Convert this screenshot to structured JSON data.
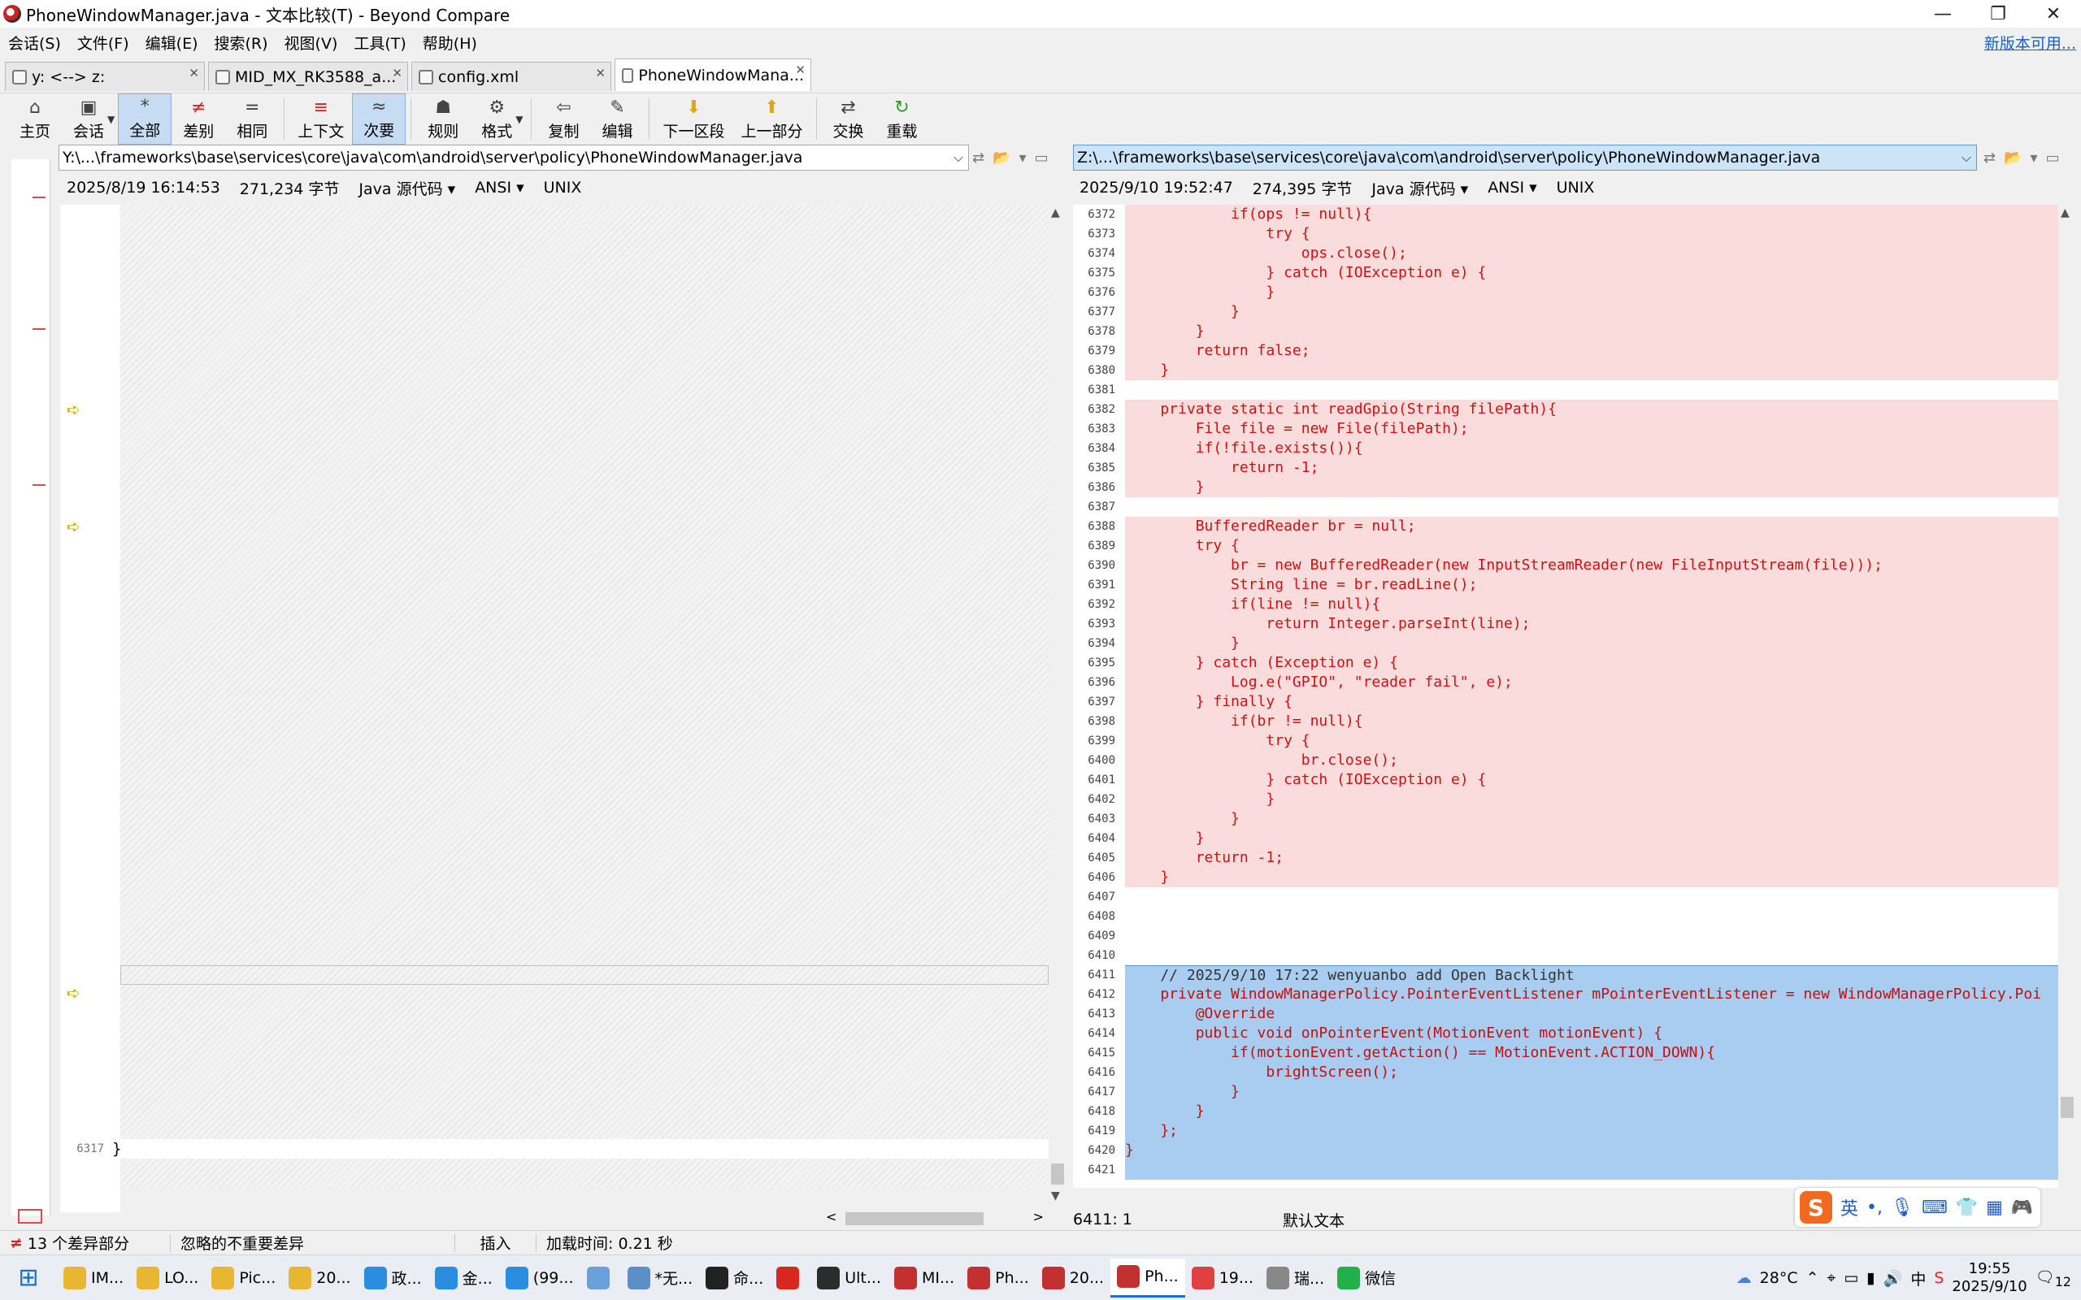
{
  "window": {
    "title": "PhoneWindowManager.java - 文本比较(T) - Beyond Compare",
    "controls": [
      "—",
      "❐",
      "✕"
    ]
  },
  "menu": {
    "items": [
      "会话(S)",
      "文件(F)",
      "编辑(E)",
      "搜索(R)",
      "视图(V)",
      "工具(T)",
      "帮助(H)"
    ],
    "update_link": "新版本可用..."
  },
  "tabs": [
    {
      "label": "y: <--> z:",
      "active": false
    },
    {
      "label": "MID_MX_RK3588_a...",
      "active": false
    },
    {
      "label": "config.xml",
      "active": false
    },
    {
      "label": "PhoneWindowMana...",
      "active": true
    }
  ],
  "toolbar": {
    "home": "主页",
    "session": "会话",
    "all": "全部",
    "diffs": "差别",
    "same": "相同",
    "context": "上下文",
    "minor": "次要",
    "rules": "规则",
    "format": "格式",
    "copy": "复制",
    "edit": "编辑",
    "next_section": "下一区段",
    "prev_section": "上一部分",
    "swap": "交换",
    "reload": "重载"
  },
  "left": {
    "path": "Y:\\...\\frameworks\\base\\services\\core\\java\\com\\android\\server\\policy\\PhoneWindowManager.java",
    "date": "2025/8/19 16:14:53",
    "size": "271,234 字节",
    "format": "Java 源代码",
    "encoding": "ANSI",
    "line_ending": "UNIX",
    "last_line_no": "6317",
    "last_line_text": "}"
  },
  "right": {
    "path": "Z:\\...\\frameworks\\base\\services\\core\\java\\com\\android\\server\\policy\\PhoneWindowManager.java",
    "date": "2025/9/10 19:52:47",
    "size": "274,395 字节",
    "format": "Java 源代码",
    "encoding": "ANSI",
    "line_ending": "UNIX",
    "lines": [
      {
        "n": "6372",
        "t": "            if(ops != null){",
        "k": "diff"
      },
      {
        "n": "6373",
        "t": "                try {",
        "k": "diff"
      },
      {
        "n": "6374",
        "t": "                    ops.close();",
        "k": "diff"
      },
      {
        "n": "6375",
        "t": "                } catch (IOException e) {",
        "k": "diff"
      },
      {
        "n": "6376",
        "t": "                }",
        "k": "diff"
      },
      {
        "n": "6377",
        "t": "            }",
        "k": "diff"
      },
      {
        "n": "6378",
        "t": "        }",
        "k": "diff"
      },
      {
        "n": "6379",
        "t": "        return false;",
        "k": "diff"
      },
      {
        "n": "6380",
        "t": "    }",
        "k": "diff"
      },
      {
        "n": "6381",
        "t": "",
        "k": "blank"
      },
      {
        "n": "6382",
        "t": "    private static int readGpio(String filePath){",
        "k": "diff"
      },
      {
        "n": "6383",
        "t": "        File file = new File(filePath);",
        "k": "diff"
      },
      {
        "n": "6384",
        "t": "        if(!file.exists()){",
        "k": "diff"
      },
      {
        "n": "6385",
        "t": "            return -1;",
        "k": "diff"
      },
      {
        "n": "6386",
        "t": "        }",
        "k": "diff"
      },
      {
        "n": "6387",
        "t": "",
        "k": "blank"
      },
      {
        "n": "6388",
        "t": "        BufferedReader br = null;",
        "k": "diff"
      },
      {
        "n": "6389",
        "t": "        try {",
        "k": "diff"
      },
      {
        "n": "6390",
        "t": "            br = new BufferedReader(new InputStreamReader(new FileInputStream(file)));",
        "k": "diff"
      },
      {
        "n": "6391",
        "t": "            String line = br.readLine();",
        "k": "diff"
      },
      {
        "n": "6392",
        "t": "            if(line != null){",
        "k": "diff"
      },
      {
        "n": "6393",
        "t": "                return Integer.parseInt(line);",
        "k": "diff"
      },
      {
        "n": "6394",
        "t": "            }",
        "k": "diff"
      },
      {
        "n": "6395",
        "t": "        } catch (Exception e) {",
        "k": "diff"
      },
      {
        "n": "6396",
        "t": "            Log.e(\"GPIO\", \"reader fail\", e);",
        "k": "diff"
      },
      {
        "n": "6397",
        "t": "        } finally {",
        "k": "diff"
      },
      {
        "n": "6398",
        "t": "            if(br != null){",
        "k": "diff"
      },
      {
        "n": "6399",
        "t": "                try {",
        "k": "diff"
      },
      {
        "n": "6400",
        "t": "                    br.close();",
        "k": "diff"
      },
      {
        "n": "6401",
        "t": "                } catch (IOException e) {",
        "k": "diff"
      },
      {
        "n": "6402",
        "t": "                }",
        "k": "diff"
      },
      {
        "n": "6403",
        "t": "            }",
        "k": "diff"
      },
      {
        "n": "6404",
        "t": "        }",
        "k": "diff"
      },
      {
        "n": "6405",
        "t": "        return -1;",
        "k": "diff"
      },
      {
        "n": "6406",
        "t": "    }",
        "k": "diff"
      },
      {
        "n": "6407",
        "t": "",
        "k": "blank"
      },
      {
        "n": "6408",
        "t": "",
        "k": "blank"
      },
      {
        "n": "6409",
        "t": "",
        "k": "blank"
      },
      {
        "n": "6410",
        "t": "",
        "k": "blank"
      },
      {
        "n": "6411",
        "t": "    // 2025/9/10 17:22 wenyuanbo add Open Backlight",
        "k": "blue first"
      },
      {
        "n": "6412",
        "t": "    private WindowManagerPolicy.PointerEventListener mPointerEventListener = new WindowManagerPolicy.Poi",
        "k": "blue"
      },
      {
        "n": "6413",
        "t": "        @Override",
        "k": "blue"
      },
      {
        "n": "6414",
        "t": "        public void onPointerEvent(MotionEvent motionEvent) {",
        "k": "blue"
      },
      {
        "n": "6415",
        "t": "            if(motionEvent.getAction() == MotionEvent.ACTION_DOWN){",
        "k": "blue"
      },
      {
        "n": "6416",
        "t": "                brightScreen();",
        "k": "blue"
      },
      {
        "n": "6417",
        "t": "            }",
        "k": "blue"
      },
      {
        "n": "6418",
        "t": "        }",
        "k": "blue"
      },
      {
        "n": "6419",
        "t": "    };",
        "k": "blue"
      },
      {
        "n": "6420",
        "t": "}",
        "k": "blue"
      },
      {
        "n": "6421",
        "t": "",
        "k": "blue"
      }
    ]
  },
  "cursor_pos": "6411: 1",
  "default_text": "默认文本",
  "status": {
    "diff_count": "13 个差异部分",
    "ignored": "忽略的不重要差异",
    "mode": "插入",
    "load_time": "加载时间: 0.21 秒"
  },
  "ime": {
    "lang": "英"
  },
  "taskbar": {
    "items": [
      {
        "label": "IM...",
        "color": "#e8b630"
      },
      {
        "label": "LO...",
        "color": "#e8b630"
      },
      {
        "label": "Pic...",
        "color": "#e8b630"
      },
      {
        "label": "20...",
        "color": "#e8b630"
      },
      {
        "label": "政...",
        "color": "#2a8de0"
      },
      {
        "label": "金...",
        "color": "#2a8de0"
      },
      {
        "label": "(99...",
        "color": "#2a8de0"
      },
      {
        "label": "",
        "color": "#6aa0d8"
      },
      {
        "label": "*无...",
        "color": "#5c8fc8"
      },
      {
        "label": "命...",
        "color": "#222222"
      },
      {
        "label": "",
        "color": "#d8281e"
      },
      {
        "label": "Ult...",
        "color": "#2c2c2c"
      },
      {
        "label": "MI...",
        "color": "#c23030"
      },
      {
        "label": "Ph...",
        "color": "#c23030"
      },
      {
        "label": "20...",
        "color": "#c23030"
      },
      {
        "label": "Ph...",
        "color": "#c23030"
      },
      {
        "label": "19...",
        "color": "#e04040"
      },
      {
        "label": "瑞...",
        "color": "#888888"
      },
      {
        "label": "微信",
        "color": "#22b04a"
      }
    ],
    "active_index": 15,
    "weather": "28°C",
    "time": "19:55",
    "date": "2025/9/10",
    "notifications": "12"
  }
}
